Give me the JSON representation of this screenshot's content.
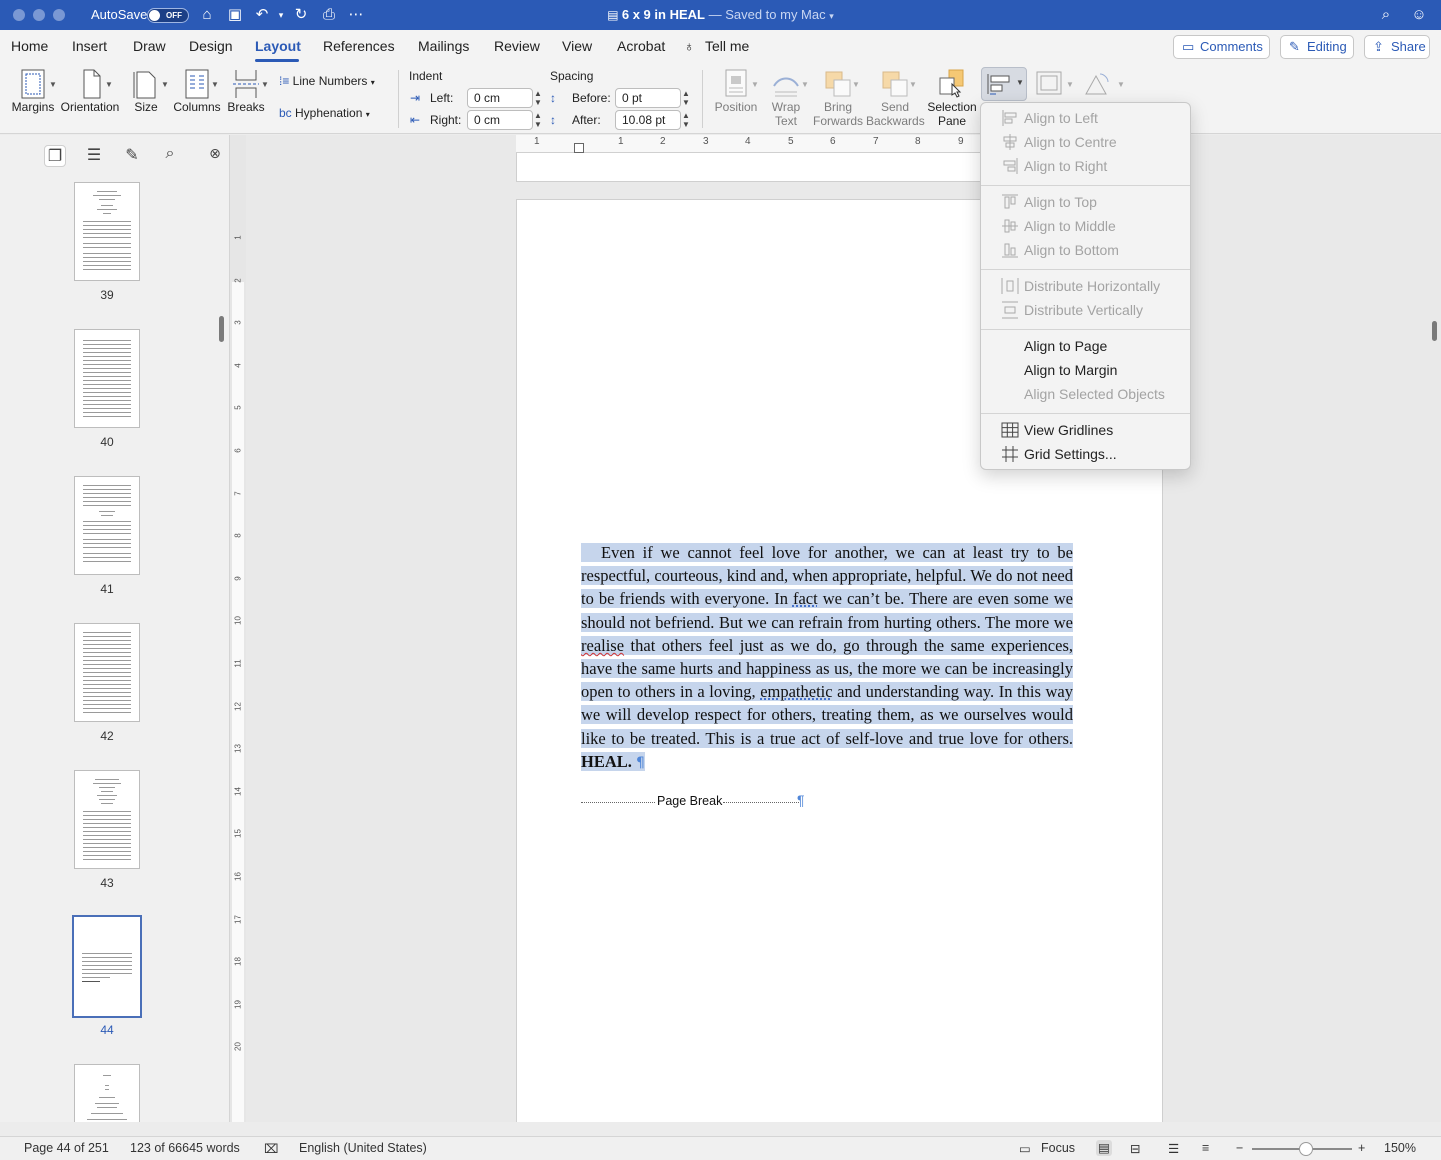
{
  "titlebar": {
    "autosave_label": "AutoSave",
    "autosave_state": "OFF",
    "doc_name": "6 x 9 in HEAL",
    "saved_status": "— Saved to my Mac"
  },
  "tabs": [
    "Home",
    "Insert",
    "Draw",
    "Design",
    "Layout",
    "References",
    "Mailings",
    "Review",
    "View",
    "Acrobat"
  ],
  "active_tab": "Layout",
  "tell_me": "Tell me",
  "actions": {
    "comments": "Comments",
    "editing": "Editing",
    "share": "Share"
  },
  "ribbon": {
    "margins": "Margins",
    "orientation": "Orientation",
    "size": "Size",
    "columns": "Columns",
    "breaks": "Breaks",
    "line_numbers": "Line Numbers",
    "hyphenation": "Hyphenation",
    "indent_title": "Indent",
    "indent_left_label": "Left:",
    "indent_left_value": "0 cm",
    "indent_right_label": "Right:",
    "indent_right_value": "0 cm",
    "spacing_title": "Spacing",
    "spacing_before_label": "Before:",
    "spacing_before_value": "0 pt",
    "spacing_after_label": "After:",
    "spacing_after_value": "10.08 pt",
    "position": "Position",
    "wrap_text_1": "Wrap",
    "wrap_text_2": "Text",
    "bring_forwards_1": "Bring",
    "bring_forwards_2": "Forwards",
    "send_backwards_1": "Send",
    "send_backwards_2": "Backwards",
    "selection_pane_1": "Selection",
    "selection_pane_2": "Pane"
  },
  "align_menu": {
    "group1": [
      "Align to Left",
      "Align to Centre",
      "Align to Right"
    ],
    "group2": [
      "Align to Top",
      "Align to Middle",
      "Align to Bottom"
    ],
    "group3": [
      "Distribute Horizontally",
      "Distribute Vertically"
    ],
    "group4": [
      "Align to Page",
      "Align to Margin",
      "Align Selected Objects"
    ],
    "group5": [
      "View Gridlines",
      "Grid Settings..."
    ]
  },
  "thumbnails": [
    "39",
    "40",
    "41",
    "42",
    "43",
    "44"
  ],
  "hruler_numbers": [
    "1",
    "1",
    "2",
    "3",
    "4",
    "5",
    "6",
    "7",
    "8",
    "9"
  ],
  "vruler_numbers": [
    "1",
    "2",
    "3",
    "4",
    "5",
    "6",
    "7",
    "8",
    "9",
    "10",
    "11",
    "12",
    "13",
    "14",
    "15",
    "16",
    "17",
    "18",
    "19",
    "20"
  ],
  "document": {
    "p1": "Even if we cannot feel love for another, we can at least try to be respectful, courteous, kind and, when appropriate, helpful.  We do not need to be friends with everyone.  In ",
    "w_fact": "fact",
    "p2": " we can’t be.  There are even some we should not befriend.  But we can refrain from hurting others.  The more we ",
    "w_realise": "realise",
    "p3": " that others feel just as we do, go through the same experiences, have the same hurts and happiness as us, the more we can be increasingly open to others in a loving, ",
    "w_empathetic": "empathetic",
    "p4": " and understanding way.  In this way we will develop respect for others, treating them, as we ourselves would like to be treated.  This is a true act of self-love and true love for others.  ",
    "bold_end": "HEAL.",
    "pilcrow": "¶",
    "page_break": "Page Break"
  },
  "status": {
    "page": "Page 44 of 251",
    "words": "123 of 66645 words",
    "language": "English (United States)",
    "focus": "Focus",
    "zoom": "150%",
    "zoom_level_percent": 150
  },
  "colors": {
    "title_bar": "#2b5ab6",
    "accent": "#2b5ab6",
    "selection_highlight": "#c6d5ec"
  }
}
